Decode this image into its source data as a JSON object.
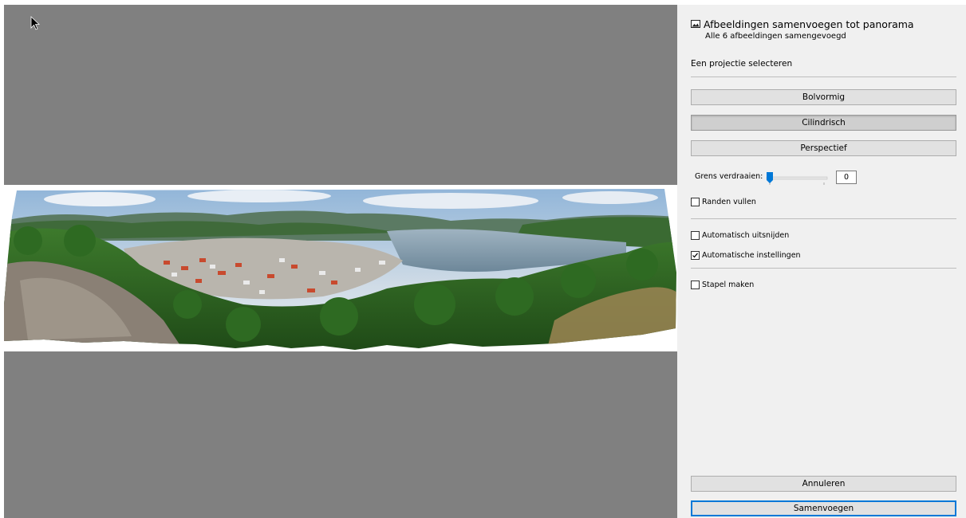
{
  "panel": {
    "title": "Afbeeldingen samenvoegen tot panorama",
    "subtitle": "Alle 6 afbeeldingen samengevoegd",
    "projection_heading": "Een projectie selecteren",
    "projections": [
      {
        "label": "Bolvormig",
        "selected": false
      },
      {
        "label": "Cilindrisch",
        "selected": true
      },
      {
        "label": "Perspectief",
        "selected": false
      }
    ],
    "warp": {
      "label": "Grens verdraaien:",
      "value": "0"
    },
    "options": {
      "fill_edges": {
        "label": "Randen vullen",
        "checked": false
      },
      "auto_crop": {
        "label": "Automatisch uitsnijden",
        "checked": false
      },
      "auto_settings": {
        "label": "Automatische instellingen",
        "checked": true
      },
      "create_stack": {
        "label": "Stapel maken",
        "checked": false
      }
    },
    "cancel_label": "Annuleren",
    "merge_label": "Samenvoegen"
  },
  "icons": {
    "title": "panorama-image-icon",
    "cursor": "arrow-cursor-icon"
  },
  "colors": {
    "preview_bg": "#808080",
    "panel_bg": "#f0f0f0",
    "focus_border": "#0078d7",
    "slider_thumb": "#0078d7"
  }
}
